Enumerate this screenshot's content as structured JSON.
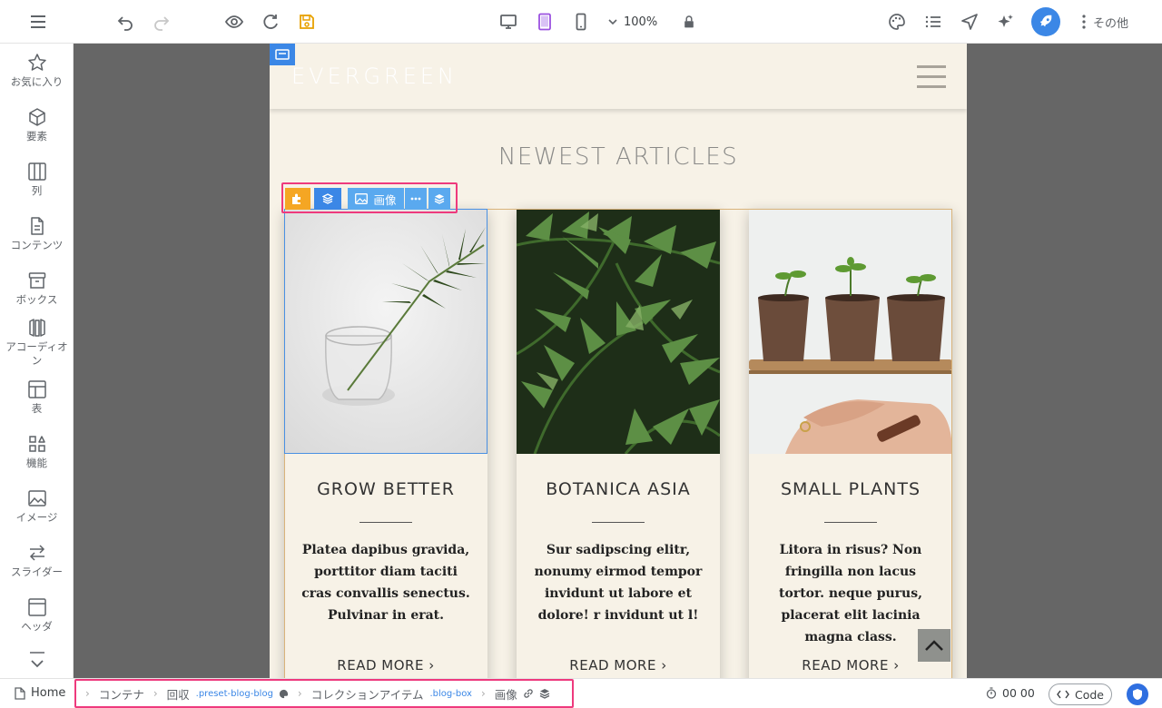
{
  "toolbar": {
    "zoom": "100%",
    "more_label": "その他",
    "accent_color": "#3b87e6",
    "icons": [
      "menu-icon",
      "undo-icon",
      "redo-icon",
      "preview-eye-icon",
      "refresh-icon",
      "save-icon",
      "desktop-icon",
      "tablet-icon",
      "mobile-icon",
      "chevron-down-icon",
      "lock-icon",
      "palette-icon",
      "list-icon",
      "send-icon",
      "ai-sparkle-icon",
      "rocket-icon",
      "kebab-icon"
    ]
  },
  "sidebar": {
    "items": [
      {
        "label": "お気に入り",
        "icon": "star-icon"
      },
      {
        "label": "要素",
        "icon": "cube-icon"
      },
      {
        "label": "列",
        "icon": "columns-icon"
      },
      {
        "label": "コンテンツ",
        "icon": "document-icon"
      },
      {
        "label": "ボックス",
        "icon": "box-icon"
      },
      {
        "label": "アコーディオン",
        "icon": "accordion-icon"
      },
      {
        "label": "表",
        "icon": "table-icon"
      },
      {
        "label": "機能",
        "icon": "features-icon"
      },
      {
        "label": "イメージ",
        "icon": "image-icon"
      },
      {
        "label": "スライダー",
        "icon": "slider-icon"
      },
      {
        "label": "ヘッダ",
        "icon": "header-icon"
      }
    ]
  },
  "site": {
    "brand": "EVERGREEN",
    "section_title": "NEWEST ARTICLES",
    "element_toolbar_label": "画像",
    "cards": [
      {
        "title": "GROW BETTER",
        "text": "Platea dapibus gravida, porttitor diam taciti cras convallis senectus. Pulvinar in erat.",
        "link": "READ MORE ›",
        "image": "palm-leaf-in-glass"
      },
      {
        "title": "BOTANICA ASIA",
        "text": "Sur sadipscing elitr, nonumy eirmod tempor invidunt ut labore et dolore! r invidunt ut l!",
        "link": "READ MORE ›",
        "image": "tropical-fern-leaves"
      },
      {
        "title": "SMALL PLANTS",
        "text": "Litora in risus? Non fringilla non lacus tortor. neque purus, placerat elit lacinia magna class.",
        "link": "READ MORE ›",
        "image": "seedlings-in-pots"
      }
    ]
  },
  "bottombar": {
    "home": "Home",
    "crumbs": [
      {
        "label": "コンテナ",
        "class": ""
      },
      {
        "label": "回収",
        "class": ".preset-blog-blog"
      },
      {
        "label": "コレクションアイテム",
        "class": ".blog-box"
      },
      {
        "label": "画像",
        "class": ""
      }
    ],
    "timer": "00 00",
    "code_label": "Code"
  }
}
